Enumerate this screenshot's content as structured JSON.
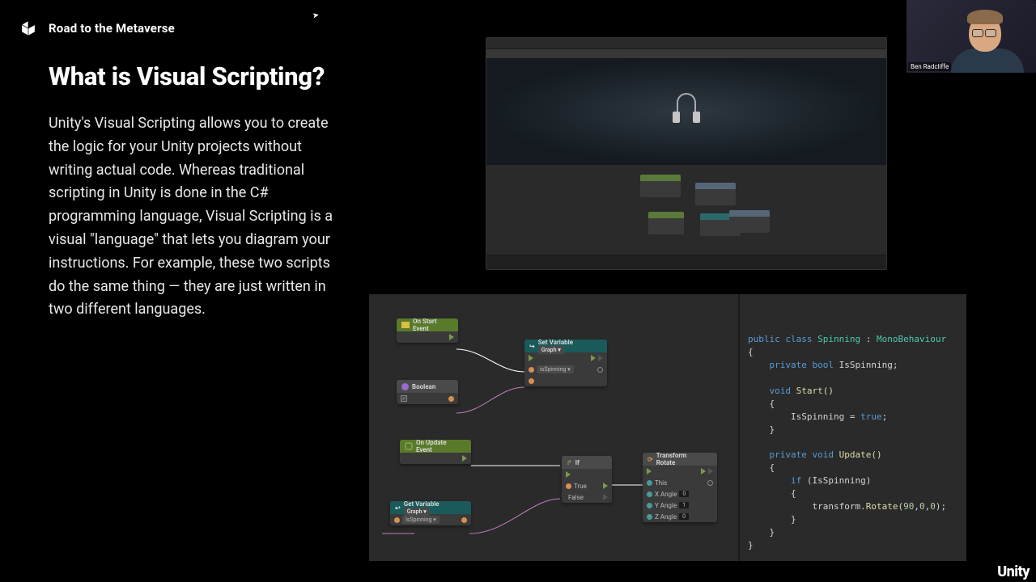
{
  "header": {
    "title": "Road to the Metaverse"
  },
  "content": {
    "title": "What is Visual Scripting?",
    "body": "Unity's Visual Scripting allows you to create the logic for your Unity projects without writing actual code. Whereas traditional scripting in Unity is done in the C# programming language, Visual Scripting is a visual \"language\" that lets you diagram your instructions. For example, these two scripts do the same thing — they are just written in two different languages."
  },
  "webcam": {
    "name": "Ben Radcliffe"
  },
  "brand": "Unity",
  "nodes": {
    "onstart": {
      "title": "On Start",
      "sub": "Event"
    },
    "onupdate": {
      "title": "On Update",
      "sub": "Event"
    },
    "boolean": {
      "title": "Boolean"
    },
    "getvar": {
      "title": "Get Variable",
      "scope": "Graph ▾",
      "var": "IsSpinning ▾"
    },
    "setvar": {
      "title": "Set Variable",
      "scope": "Graph ▾",
      "var": "isSpinning ▾"
    },
    "if": {
      "title": "If",
      "t": "True",
      "f": "False"
    },
    "rotate": {
      "title": "Transform",
      "sub": "Rotate",
      "this": "This",
      "xa": "X Angle",
      "ya": "Y Angle",
      "za": "Z Angle",
      "xv": "0",
      "yv": "1",
      "zv": "0"
    }
  },
  "code": {
    "l1a": "public",
    "l1b": "class",
    "l1c": "Spinning",
    "l1d": ":",
    "l1e": "MonoBehaviour",
    "l3a": "private",
    "l3b": "bool",
    "l3c": "IsSpinning;",
    "l5a": "void",
    "l5b": "Start()",
    "l7": "IsSpinning = ",
    "l7b": "true",
    "l7c": ";",
    "l10a": "private",
    "l10b": "void",
    "l10c": "Update()",
    "l12a": "if",
    "l12b": "(IsSpinning)",
    "l14a": "transform.",
    "l14b": "Rotate",
    "l14c": "(",
    "l14d": "90",
    "l14e": ",",
    "l14f": "0",
    "l14g": ",",
    "l14h": "0",
    "l14i": ");"
  }
}
